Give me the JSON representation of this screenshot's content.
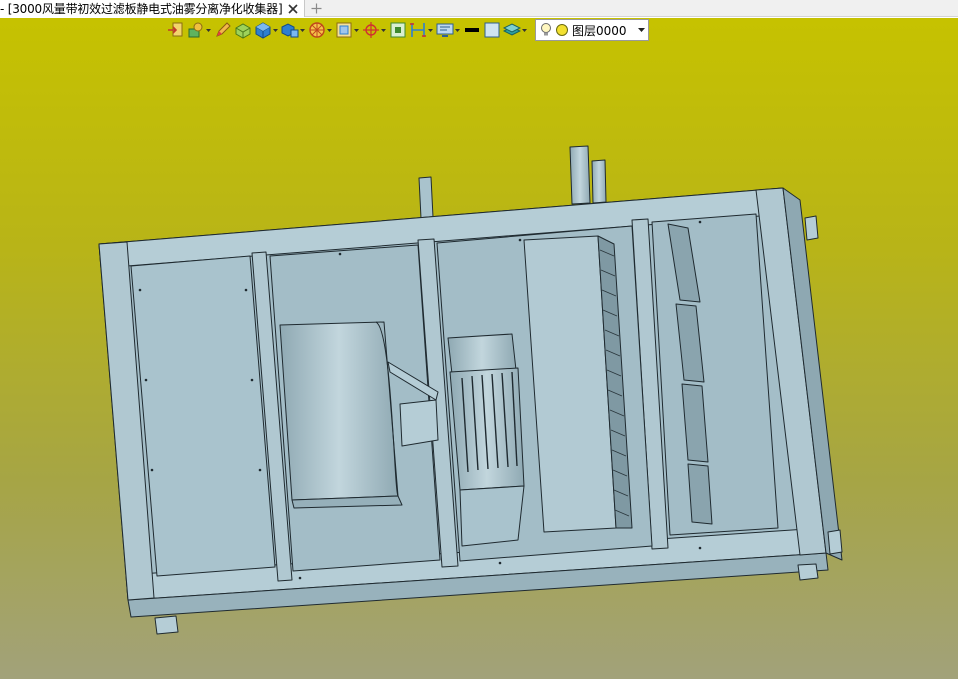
{
  "document_tab": {
    "title": "- [3000风量带初效过滤板静电式油雾分离净化收集器]",
    "close_icon": "close-icon",
    "new_tab_icon": "plus-icon"
  },
  "toolbar": {
    "tools": [
      {
        "name": "import-icon",
        "dropdown": false
      },
      {
        "name": "layer-tools-icon",
        "dropdown": true
      },
      {
        "name": "pencil-icon",
        "dropdown": false
      },
      {
        "name": "block-icon",
        "dropdown": false
      },
      {
        "name": "solid-cube-icon",
        "dropdown": true
      },
      {
        "name": "shaded-view-icon",
        "dropdown": true
      },
      {
        "name": "render-wheel-icon",
        "dropdown": true
      },
      {
        "name": "zoom-window-icon",
        "dropdown": true
      },
      {
        "name": "orbit-axis-icon",
        "dropdown": true
      },
      {
        "name": "fit-frame-icon",
        "dropdown": false
      },
      {
        "name": "section-icon",
        "dropdown": true
      },
      {
        "name": "display-settings-icon",
        "dropdown": true
      },
      {
        "name": "line-color-icon",
        "dropdown": false
      },
      {
        "name": "fill-color-icon",
        "dropdown": false
      },
      {
        "name": "layer-stack-icon",
        "dropdown": true
      }
    ],
    "layer_select": {
      "value": "图层0000",
      "visible_icon": "lightbulb-icon",
      "state_icon": "layer-state-dot-icon"
    }
  },
  "colors": {
    "model_body": "#a9c3cd",
    "model_edge": "#1f2a30",
    "toolbar_accent": "#2e7fd0"
  }
}
